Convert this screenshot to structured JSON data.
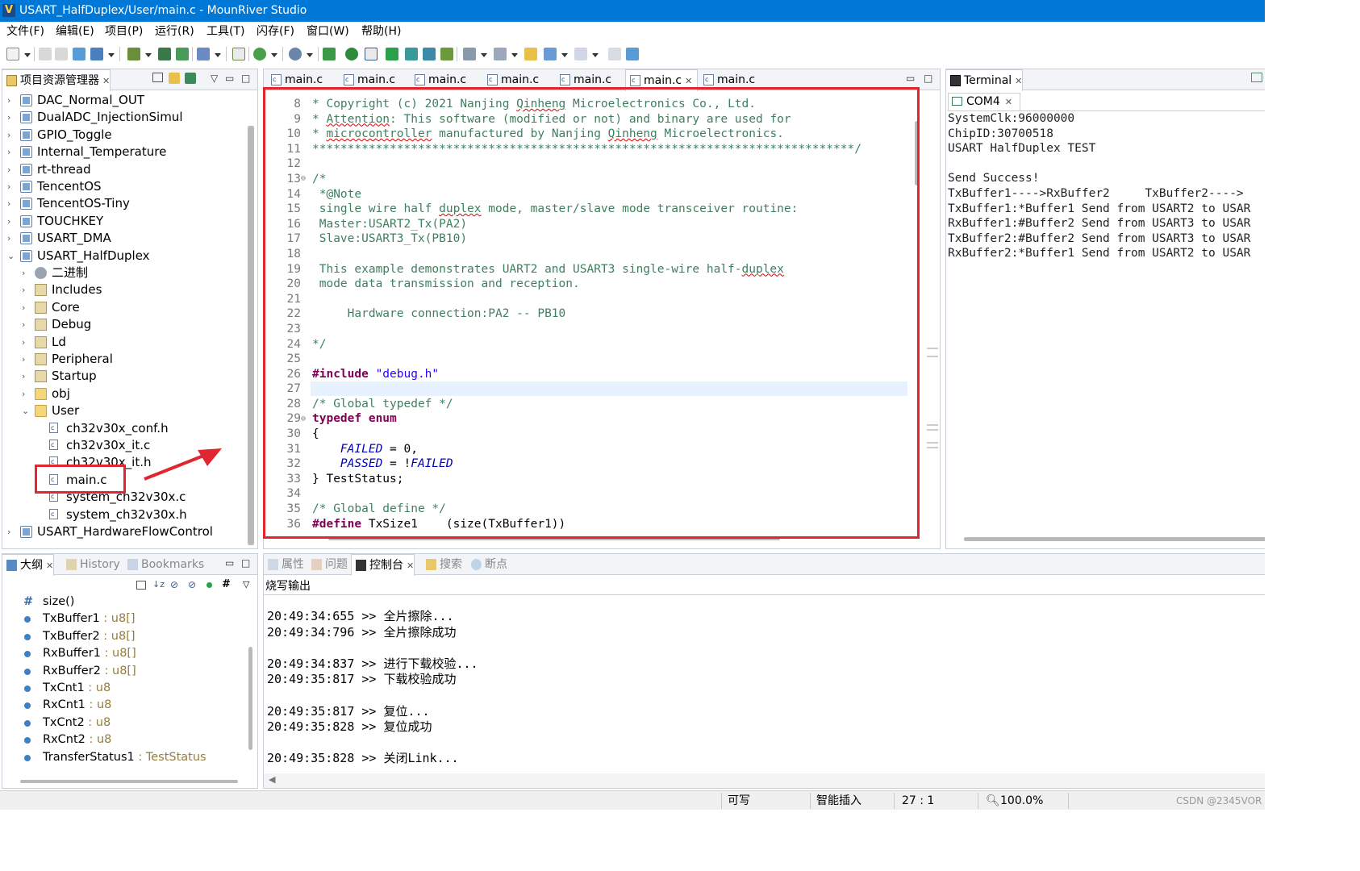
{
  "window": {
    "title": "USART_HalfDuplex/User/main.c - MounRiver Studio"
  },
  "menu": [
    "文件(F)",
    "编辑(E)",
    "项目(P)",
    "运行(R)",
    "工具(T)",
    "闪存(F)",
    "窗口(W)",
    "帮助(H)"
  ],
  "explorer": {
    "title": "项目资源管理器",
    "items": [
      {
        "label": "DAC_Normal_OUT"
      },
      {
        "label": "DualADC_InjectionSimul"
      },
      {
        "label": "GPIO_Toggle"
      },
      {
        "label": "Internal_Temperature"
      },
      {
        "label": "rt-thread"
      },
      {
        "label": "TencentOS"
      },
      {
        "label": "TencentOS-Tiny"
      },
      {
        "label": "TOUCHKEY"
      },
      {
        "label": "USART_DMA"
      },
      {
        "label": "USART_HalfDuplex"
      },
      {
        "label": "二进制"
      },
      {
        "label": "Includes"
      },
      {
        "label": "Core"
      },
      {
        "label": "Debug"
      },
      {
        "label": "Ld"
      },
      {
        "label": "Peripheral"
      },
      {
        "label": "Startup"
      },
      {
        "label": "obj"
      },
      {
        "label": "User"
      },
      {
        "label": "ch32v30x_conf.h"
      },
      {
        "label": "ch32v30x_it.c"
      },
      {
        "label": "ch32v30x_it.h"
      },
      {
        "label": "main.c"
      },
      {
        "label": "system_ch32v30x.c"
      },
      {
        "label": "system_ch32v30x.h"
      },
      {
        "label": "USART_HardwareFlowControl"
      }
    ]
  },
  "editor": {
    "tabs": [
      "main.c",
      "main.c",
      "main.c",
      "main.c",
      "main.c",
      "main.c",
      "main.c"
    ],
    "line_numbers": [
      "8",
      "9",
      "10",
      "11",
      "12",
      "13",
      "14",
      "15",
      "16",
      "17",
      "18",
      "19",
      "20",
      "21",
      "22",
      "23",
      "24",
      "25",
      "26",
      "27",
      "28",
      "29",
      "30",
      "31",
      "32",
      "33",
      "34",
      "35",
      "36"
    ],
    "lines": [
      "* Copyright (c) 2021 Nanjing Qinheng Microelectronics Co., Ltd.",
      "* Attention: This software (modified or not) and binary are used for",
      "* microcontroller manufactured by Nanjing Qinheng Microelectronics.",
      "*****************************************************************************/",
      "",
      "/*",
      " *@Note",
      " single wire half duplex mode, master/slave mode transceiver routine:",
      " Master:USART2_Tx(PA2)",
      " Slave:USART3_Tx(PB10)",
      "",
      " This example demonstrates UART2 and USART3 single-wire half-duplex",
      " mode data transmission and reception.",
      "",
      "     Hardware connection:PA2 -- PB10",
      "",
      "*/",
      "",
      "#include \"debug.h\"",
      "",
      "/* Global typedef */",
      "typedef enum",
      "{",
      "    FAILED = 0,",
      "    PASSED = !FAILED",
      "} TestStatus;",
      "",
      "/* Global define */",
      "#define TxSize1    (size(TxBuffer1))"
    ]
  },
  "terminal": {
    "title": "Terminal",
    "tab": "COM4",
    "lines": [
      "SystemClk:96000000",
      "ChipID:30700518",
      "USART HalfDuplex TEST",
      "",
      "Send Success!",
      "TxBuffer1---->RxBuffer2     TxBuffer2---->",
      "TxBuffer1:*Buffer1 Send from USART2 to USAR",
      "RxBuffer1:#Buffer2 Send from USART3 to USAR",
      "TxBuffer2:#Buffer2 Send from USART3 to USAR",
      "RxBuffer2:*Buffer1 Send from USART2 to USAR"
    ]
  },
  "outline": {
    "tabs": [
      "大纲",
      "History",
      "Bookmarks"
    ],
    "items": [
      {
        "name": "size()",
        "type": ""
      },
      {
        "name": "TxBuffer1",
        "type": " : u8[]"
      },
      {
        "name": "TxBuffer2",
        "type": " : u8[]"
      },
      {
        "name": "RxBuffer1",
        "type": " : u8[]"
      },
      {
        "name": "RxBuffer2",
        "type": " : u8[]"
      },
      {
        "name": "TxCnt1",
        "type": " : u8"
      },
      {
        "name": "RxCnt1",
        "type": " : u8"
      },
      {
        "name": "TxCnt2",
        "type": " : u8"
      },
      {
        "name": "RxCnt2",
        "type": " : u8"
      },
      {
        "name": "TransferStatus1",
        "type": " : TestStatus"
      }
    ]
  },
  "console": {
    "tabs": [
      "属性",
      "问题",
      "控制台",
      "搜索",
      "断点"
    ],
    "header": "烧写输出",
    "lines": [
      "20:49:34:655 >> 全片擦除...",
      "20:49:34:796 >> 全片擦除成功",
      "",
      "20:49:34:837 >> 进行下载校验...",
      "20:49:35:817 >> 下载校验成功",
      "",
      "20:49:35:817 >> 复位...",
      "20:49:35:828 >> 复位成功",
      "",
      "20:49:35:828 >> 关闭Link..."
    ]
  },
  "status": {
    "writable": "可写",
    "insert_mode": "智能插入",
    "position": "27 : 1",
    "zoom": "100.0%",
    "watermark": "CSDN @2345VOR"
  }
}
